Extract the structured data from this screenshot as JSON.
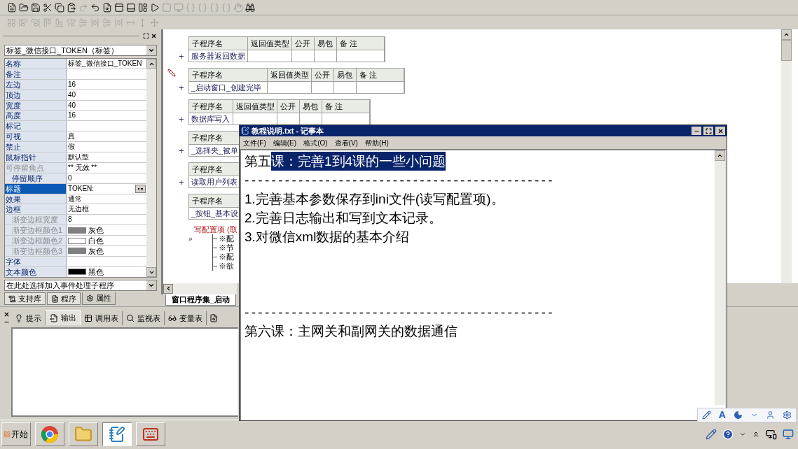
{
  "left_panel": {
    "object_combo": "标签_微信接口_TOKEN（标签）",
    "properties": [
      {
        "label": "名称",
        "value": "标签_微信接口_TOKEN",
        "kind": "text",
        "disabled": false,
        "selected": false
      },
      {
        "label": "备注",
        "kind": "text",
        "disabled": false,
        "selected": false
      },
      {
        "label": "左边",
        "value": "16",
        "kind": "text",
        "disabled": false,
        "selected": false
      },
      {
        "label": "顶边",
        "value": "40",
        "kind": "text",
        "disabled": false,
        "selected": false
      },
      {
        "label": "宽度",
        "value": "40",
        "kind": "text",
        "disabled": false,
        "selected": false
      },
      {
        "label": "高度",
        "value": "16",
        "kind": "text",
        "disabled": false,
        "selected": false
      },
      {
        "label": "标记",
        "kind": "text",
        "disabled": false,
        "selected": false
      },
      {
        "label": "可视",
        "value": "真",
        "kind": "text",
        "disabled": false,
        "selected": false
      },
      {
        "label": "禁止",
        "value": "假",
        "kind": "text",
        "disabled": false,
        "selected": false
      },
      {
        "label": "鼠标指针",
        "value": "默认型",
        "kind": "text",
        "disabled": false,
        "selected": false
      },
      {
        "label": "可停留焦点",
        "value": "** 无效 **",
        "kind": "text",
        "disabled": true,
        "selected": false,
        "children": [
          {
            "label": "停留顺序",
            "value": "0",
            "kind": "text",
            "disabled": false,
            "selected": false
          }
        ]
      },
      {
        "label": "标题",
        "value": "TOKEN:",
        "kind": "ellipsis",
        "disabled": false,
        "selected": true
      },
      {
        "label": "效果",
        "value": "通常",
        "kind": "text",
        "disabled": false,
        "selected": false
      },
      {
        "label": "边框",
        "value": "无边框",
        "kind": "text",
        "disabled": false,
        "selected": false,
        "children": [
          {
            "label": "渐变边框宽度",
            "value": "8",
            "kind": "text",
            "disabled": true,
            "selected": false
          },
          {
            "label": "渐变边框颜色1",
            "value": "灰色",
            "kind": "color",
            "color": "#808080",
            "disabled": true,
            "selected": false
          },
          {
            "label": "渐变边框颜色2",
            "value": "白色",
            "kind": "color",
            "color": "#ffffff",
            "disabled": true,
            "selected": false
          },
          {
            "label": "渐变边框颜色3",
            "value": "灰色",
            "kind": "color",
            "color": "#808080",
            "disabled": true,
            "selected": false
          }
        ]
      },
      {
        "label": "字体",
        "kind": "text",
        "disabled": false,
        "selected": false
      },
      {
        "label": "文本颜色",
        "value": "黑色",
        "kind": "color",
        "color": "#000000",
        "disabled": false,
        "selected": false
      }
    ],
    "event_combo": "在此处选择加入事件处理子程序",
    "tabs": [
      {
        "label": "支持库",
        "selected": false
      },
      {
        "label": "程序",
        "selected": false
      },
      {
        "label": "属性",
        "selected": true
      }
    ]
  },
  "code_blocks": [
    {
      "headers": [
        "子程序名",
        "返回值类型",
        "公开",
        "易包",
        "备 注"
      ],
      "name": "服务器返回数据",
      "expander": "+",
      "marked": false
    },
    {
      "headers": [
        "子程序名",
        "返回值类型",
        "公开",
        "易包",
        "备 注"
      ],
      "name": "_启动窗口_创建完毕",
      "expander": "+",
      "marked": true
    },
    {
      "headers": [
        "子程序名",
        "返回值类型",
        "公开",
        "易包",
        "备 注"
      ],
      "name": "数据库写入",
      "expander": "+",
      "marked": false
    },
    {
      "headers": [
        "子程序名"
      ],
      "name": "_选择夹_被单",
      "expander": "+",
      "marked": false
    },
    {
      "headers": [
        "子程序名"
      ],
      "name": "读取用户列表",
      "expander": "+",
      "marked": false
    },
    {
      "headers": [
        "子程序名"
      ],
      "name": "_按钮_基本设",
      "marked": false
    }
  ],
  "config_tree": {
    "title": "写配置项 (取",
    "marker": "»",
    "items": [
      "※配",
      "※节",
      "※配",
      "※欲"
    ]
  },
  "code_tab": "窗口程序集_启动",
  "bottom_tabs": [
    {
      "label": "提示",
      "selected": false
    },
    {
      "label": "输出",
      "selected": true
    },
    {
      "label": "调用表",
      "selected": false
    },
    {
      "label": "监视表",
      "selected": false
    },
    {
      "label": "变量表",
      "selected": false
    }
  ],
  "notepad": {
    "title": "教程说明.txt - 记事本",
    "menu": [
      "文件(F)",
      "编辑(E)",
      "格式(O)",
      "查看(V)",
      "帮助(H)"
    ],
    "lines": [
      {
        "kind": "heading",
        "text": "第五",
        "selection": "课：完善1到4课的一些小问题"
      },
      {
        "kind": "rule",
        "text": "----------------------------------------------"
      },
      {
        "kind": "text",
        "text": "1.完善基本参数保存到ini文件(读写配置项)。"
      },
      {
        "kind": "text",
        "text": "2.完善日志输出和写到文本记录。"
      },
      {
        "kind": "text",
        "text": "3.对微信xml数据的基本介绍"
      },
      {
        "kind": "blank"
      },
      {
        "kind": "blank"
      },
      {
        "kind": "blank"
      },
      {
        "kind": "rule",
        "text": "----------------------------------------------"
      },
      {
        "kind": "text",
        "text": "第六课：主网关和副网关的数据通信"
      }
    ]
  },
  "taskbar": {
    "start": "开始",
    "apps": [
      {
        "kind": "browser",
        "selected": false
      },
      {
        "kind": "folder",
        "selected": false
      },
      {
        "kind": "notepad",
        "selected": true
      },
      {
        "kind": "editor",
        "selected": false
      }
    ]
  },
  "language_bar": {
    "letter": "A"
  }
}
